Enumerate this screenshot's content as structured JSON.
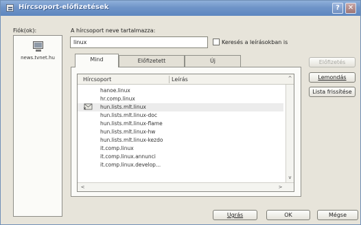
{
  "window": {
    "title": "Hírcsoport-előfizetések"
  },
  "accounts": {
    "label": "Fiók(ok):",
    "items": [
      {
        "name": "news.tvnet.hu"
      }
    ]
  },
  "search": {
    "label": "A hírcsoport neve tartalmazza:",
    "value": "linux",
    "checkbox_label": "Keresés a leírásokban is",
    "checkbox_checked": false
  },
  "tabs": [
    {
      "label": "Mind",
      "active": true
    },
    {
      "label": "Előfizetett",
      "active": false
    },
    {
      "label": "Új",
      "active": false
    }
  ],
  "list": {
    "columns": [
      "Hírcsoport",
      "Leírás"
    ],
    "rows": [
      {
        "name": "hanoe.linux",
        "subscribed": false
      },
      {
        "name": "hr.comp.linux",
        "subscribed": false
      },
      {
        "name": "hun.lists.mlt.linux",
        "subscribed": true
      },
      {
        "name": "hun.lists.mlt.linux-doc",
        "subscribed": false
      },
      {
        "name": "hun.lists.mlt.linux-flame",
        "subscribed": false
      },
      {
        "name": "hun.lists.mlt.linux-hw",
        "subscribed": false
      },
      {
        "name": "hun.lists.mlt.linux-kezdo",
        "subscribed": false
      },
      {
        "name": "it.comp.linux",
        "subscribed": false
      },
      {
        "name": "it.comp.linux.annunci",
        "subscribed": false
      },
      {
        "name": "it.comp.linux.develop...",
        "subscribed": false
      }
    ]
  },
  "side_buttons": {
    "subscribe": "Előfizetés",
    "unsubscribe": "Lemondás",
    "reset": "Lista frissítése"
  },
  "footer_buttons": {
    "goto": "Ugrás",
    "ok": "OK",
    "cancel": "Mégse"
  },
  "icons": {
    "title": "window-icon",
    "account": "server-icon",
    "subscribed": "newsgroup-subscribed-icon"
  }
}
